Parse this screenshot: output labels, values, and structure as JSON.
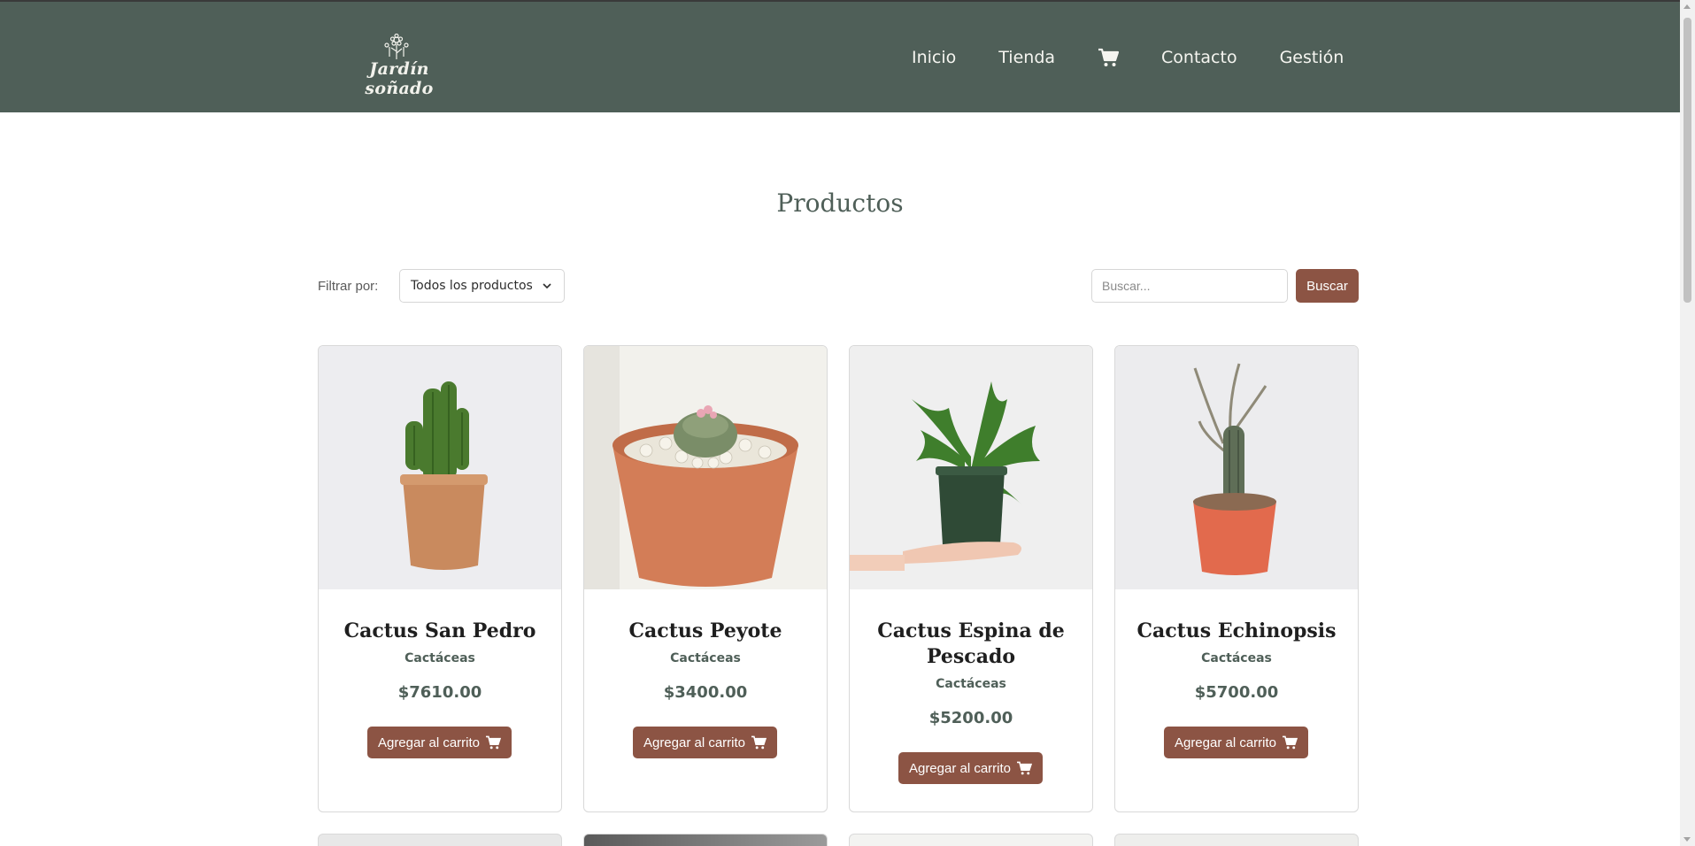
{
  "brand": {
    "name": "Jardín soñado",
    "header_color": "#4f5f58",
    "accent_color": "#8c5444"
  },
  "nav": {
    "items": [
      {
        "label": "Inicio"
      },
      {
        "label": "Tienda"
      },
      {
        "label": "",
        "icon": "cart-icon"
      },
      {
        "label": "Contacto"
      },
      {
        "label": "Gestión"
      }
    ]
  },
  "page": {
    "title": "Productos"
  },
  "filter": {
    "label": "Filtrar por:",
    "selected": "Todos los productos"
  },
  "search": {
    "placeholder": "Buscar...",
    "button": "Buscar"
  },
  "products": [
    {
      "name": "Cactus San Pedro",
      "category": "Cactáceas",
      "price": "$7610.00",
      "button": "Agregar al carrito"
    },
    {
      "name": "Cactus Peyote",
      "category": "Cactáceas",
      "price": "$3400.00",
      "button": "Agregar al carrito"
    },
    {
      "name": "Cactus Espina de Pescado",
      "category": "Cactáceas",
      "price": "$5200.00",
      "button": "Agregar al carrito"
    },
    {
      "name": "Cactus Echinopsis",
      "category": "Cactáceas",
      "price": "$5700.00",
      "button": "Agregar al carrito"
    }
  ]
}
